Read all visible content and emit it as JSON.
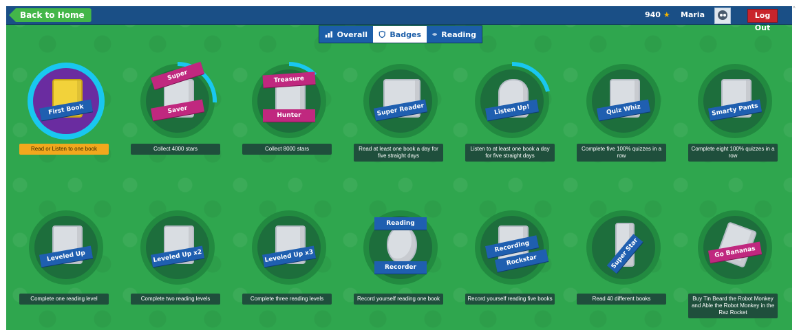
{
  "topbar": {
    "back_label": "Back to Home",
    "stars": "940",
    "username": "Maria",
    "logout_label": "Log Out"
  },
  "tabs": [
    {
      "label": "Overall",
      "icon": "bar-chart-icon",
      "active": false
    },
    {
      "label": "Badges",
      "icon": "shield-icon",
      "active": true
    },
    {
      "label": "Reading",
      "icon": "rocket-icon",
      "active": false
    }
  ],
  "badges_row1": [
    {
      "title": "First Book",
      "caption": "Read or Listen to one book",
      "highlight": true,
      "progress": 1.0,
      "earned": true
    },
    {
      "title_top": "Super",
      "title_bottom": "Saver",
      "caption": "Collect 4000 stars",
      "progress": 0.3
    },
    {
      "title_top": "Treasure",
      "title_bottom": "Hunter",
      "caption": "Collect 8000 stars",
      "progress": 0.15
    },
    {
      "title": "Super Reader",
      "caption": "Read at least one book a day for five straight days",
      "progress": 0
    },
    {
      "title": "Listen Up!",
      "caption": "Listen to at least one book a day for five straight days",
      "progress": 0.25
    },
    {
      "title": "Quiz Whiz",
      "caption": "Complete five 100% quizzes in a row",
      "progress": 0
    },
    {
      "title": "Smarty Pants",
      "caption": "Complete eight 100% quizzes in a row",
      "progress": 0
    }
  ],
  "badges_row2": [
    {
      "title": "Leveled Up",
      "caption": "Complete one reading level"
    },
    {
      "title": "Leveled Up x2",
      "caption": "Complete two reading levels"
    },
    {
      "title": "Leveled Up x3",
      "caption": "Complete three reading levels"
    },
    {
      "title_top": "Reading",
      "title_bottom": "Recorder",
      "caption": "Record yourself reading one book"
    },
    {
      "title_top": "Recording",
      "title_bottom": "Rockstar",
      "caption": "Record yourself reading five books"
    },
    {
      "title": "Super Star",
      "caption": "Read 40 different books"
    },
    {
      "title": "Go Bananas",
      "caption": "Buy Tin Beard the Robot Monkey and Able the Robot Monkey in the Raz Rocket"
    }
  ],
  "colors": {
    "background": "#2fa64e",
    "topbar": "#1a4f86",
    "progress_ring": "#19c7f0",
    "earned_inner": "#6a2ca0",
    "highlight_caption": "#f2a81d",
    "logout": "#c9242b"
  }
}
